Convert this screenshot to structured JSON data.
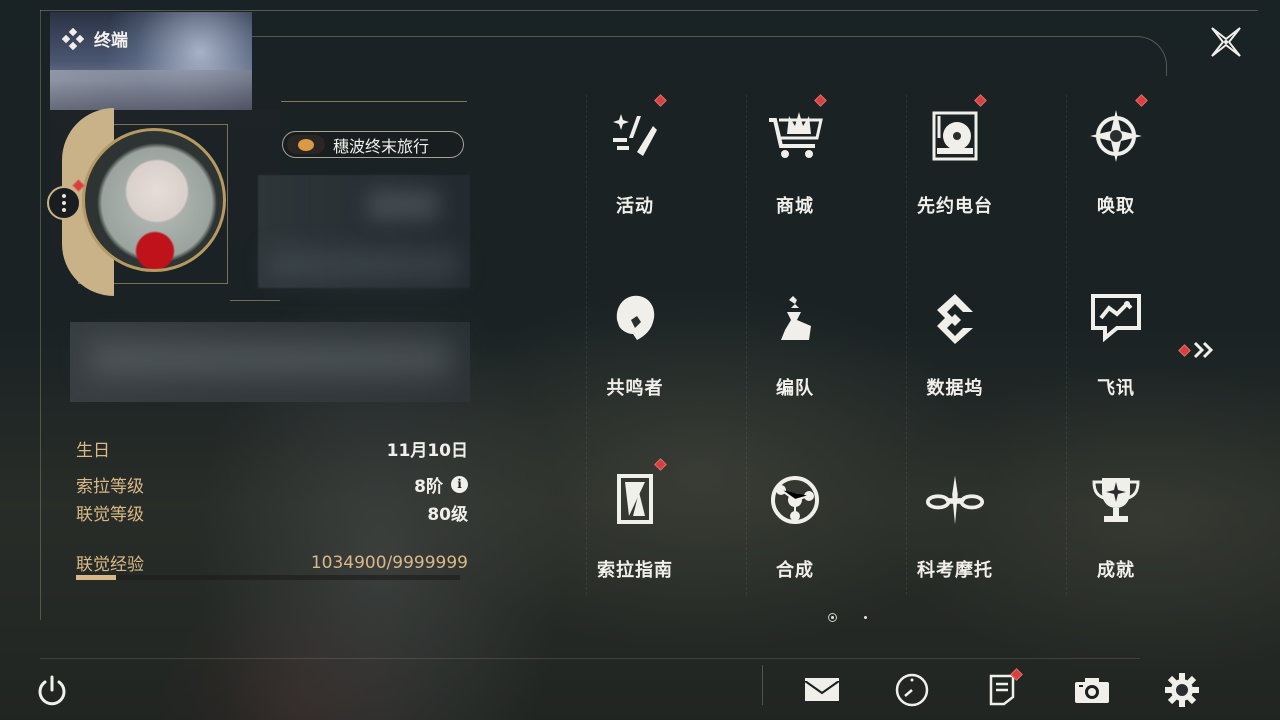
{
  "header": {
    "title": "终端"
  },
  "profile": {
    "name": "穗波终末旅行"
  },
  "stats": {
    "birthday_label": "生日",
    "birthday_value": "11月10日",
    "sola_level_label": "索拉等级",
    "sola_level_value": "8阶",
    "union_level_label": "联觉等级",
    "union_level_value": "80级",
    "union_exp_label": "联觉经验",
    "union_exp_value": "1034900/9999999",
    "union_exp_fraction": 0.103
  },
  "menu": {
    "items": [
      {
        "label": "活动",
        "icon": "event-sparkle-icon",
        "badge": true
      },
      {
        "label": "商城",
        "icon": "shop-cart-icon",
        "badge": true
      },
      {
        "label": "先约电台",
        "icon": "radio-turntable-icon",
        "badge": true
      },
      {
        "label": "唤取",
        "icon": "convene-compass-icon",
        "badge": true
      },
      {
        "label": "共鸣者",
        "icon": "resonator-portrait-icon",
        "badge": false
      },
      {
        "label": "编队",
        "icon": "team-chess-icon",
        "badge": false
      },
      {
        "label": "数据坞",
        "icon": "data-bank-icon",
        "badge": false
      },
      {
        "label": "飞讯",
        "icon": "message-chat-icon",
        "badge": false
      },
      {
        "label": "索拉指南",
        "icon": "sola-guide-icon",
        "badge": true
      },
      {
        "label": "合成",
        "icon": "synthesis-orbit-icon",
        "badge": false
      },
      {
        "label": "科考摩托",
        "icon": "motorbike-icon",
        "badge": false
      },
      {
        "label": "成就",
        "icon": "trophy-icon",
        "badge": false
      }
    ]
  },
  "colors": {
    "accent_gold": "#d9b987",
    "badge_red": "#d8403f",
    "text_light": "#f1efea"
  }
}
